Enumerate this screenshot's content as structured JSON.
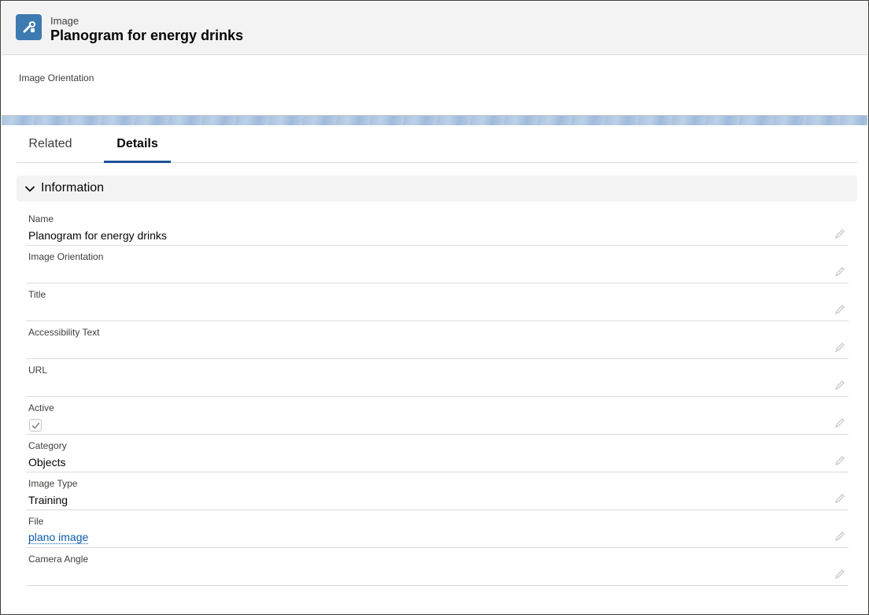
{
  "header": {
    "object_type": "Image",
    "record_title": "Planogram for energy drinks",
    "highlights": [
      "Image Orientation"
    ]
  },
  "tabs": [
    {
      "label": "Related",
      "active": false
    },
    {
      "label": "Details",
      "active": true
    }
  ],
  "section": {
    "title": "Information",
    "expanded": true
  },
  "fields": {
    "name": {
      "label": "Name",
      "value": "Planogram for energy drinks"
    },
    "image_orientation": {
      "label": "Image Orientation",
      "value": ""
    },
    "title": {
      "label": "Title",
      "value": ""
    },
    "accessibility_text": {
      "label": "Accessibility Text",
      "value": ""
    },
    "url": {
      "label": "URL",
      "value": ""
    },
    "active": {
      "label": "Active",
      "checked": true
    },
    "category": {
      "label": "Category",
      "value": "Objects"
    },
    "image_type": {
      "label": "Image Type",
      "value": "Training"
    },
    "file": {
      "label": "File",
      "value": "plano image"
    },
    "camera_angle": {
      "label": "Camera Angle",
      "value": ""
    }
  },
  "icons": {
    "object_icon": "image-tool-icon",
    "chevron": "chevron-down-icon",
    "edit": "pencil-icon",
    "check": "check-icon"
  },
  "colors": {
    "brand_icon_bg": "#3c7ab0",
    "active_tab_underline": "#1b5297",
    "link": "#0b5cab"
  }
}
